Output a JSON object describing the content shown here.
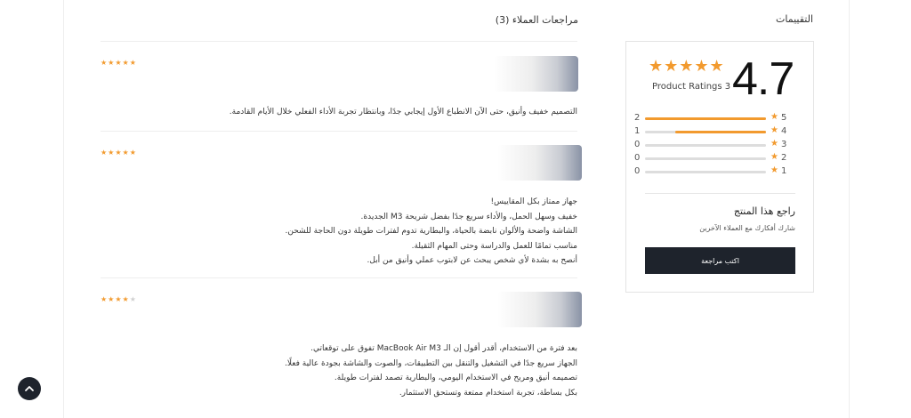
{
  "ratings": {
    "heading": "التقييمات",
    "average": "4.7",
    "stars": "★★★★★",
    "count_label": "Product Ratings 3",
    "distribution": [
      {
        "star": "★",
        "level": "5",
        "count": "2",
        "fill": 1.0
      },
      {
        "star": "★",
        "level": "4",
        "count": "1",
        "fill": 0.75
      },
      {
        "star": "★",
        "level": "3",
        "count": "0",
        "fill": 0.0
      },
      {
        "star": "★",
        "level": "2",
        "count": "0",
        "fill": 0.0
      },
      {
        "star": "★",
        "level": "1",
        "count": "0",
        "fill": 0.0
      }
    ],
    "review_product_title": "راجع هذا المنتج",
    "review_product_subtitle": "شارك أفكارك مع العملاء الآخرين",
    "write_review_label": "اكتب مراجعة"
  },
  "reviews": {
    "heading": "مراجعات العملاء (3)",
    "items": [
      {
        "stars_on": "★★★★★",
        "stars_off": "",
        "rating": 5,
        "lines": [
          "التصميم خفيف وأنيق، حتى الآن الانطباع الأول إيجابي جدًا، وبانتظار تجربة الأداء الفعلي خلال الأيام القادمة."
        ]
      },
      {
        "stars_on": "★★★★★",
        "stars_off": "",
        "rating": 5,
        "lines": [
          "جهاز ممتاز بكل المقاييس!",
          "خفيف وسهل الحمل، والأداء سريع جدًا بفضل شريحة M3 الجديدة.",
          "الشاشة واضحة والألوان نابضة بالحياة، والبطارية تدوم لفترات طويلة دون الحاجة للشحن.",
          "مناسب تمامًا للعمل والدراسة وحتى المهام الثقيلة.",
          "أنصح به بشدة لأي شخص يبحث عن لابتوب عملي وأنيق من أبل."
        ]
      },
      {
        "stars_on": "★★★★",
        "stars_off": "★",
        "rating": 4,
        "lines": [
          "بعد فترة من الاستخدام، أقدر أقول إن الـ MacBook Air M3 تفوق على توقعاتي.",
          "الجهاز سريع جدًا في التشغيل والتنقل بين التطبيقات، والصوت والشاشة بجودة عالية فعلًا.",
          "تصميمه أنيق ومريح في الاستخدام اليومي، والبطارية تصمد لفترات طويلة.",
          "بكل بساطة، تجربة استخدام ممتعة وتستحق الاستثمار."
        ]
      }
    ]
  },
  "icons": {
    "back_to_top": "chevron-up-icon",
    "star": "star-icon"
  },
  "colors": {
    "accent": "#f29a2e",
    "button_dark": "#1e232c",
    "track": "#dddddd"
  }
}
